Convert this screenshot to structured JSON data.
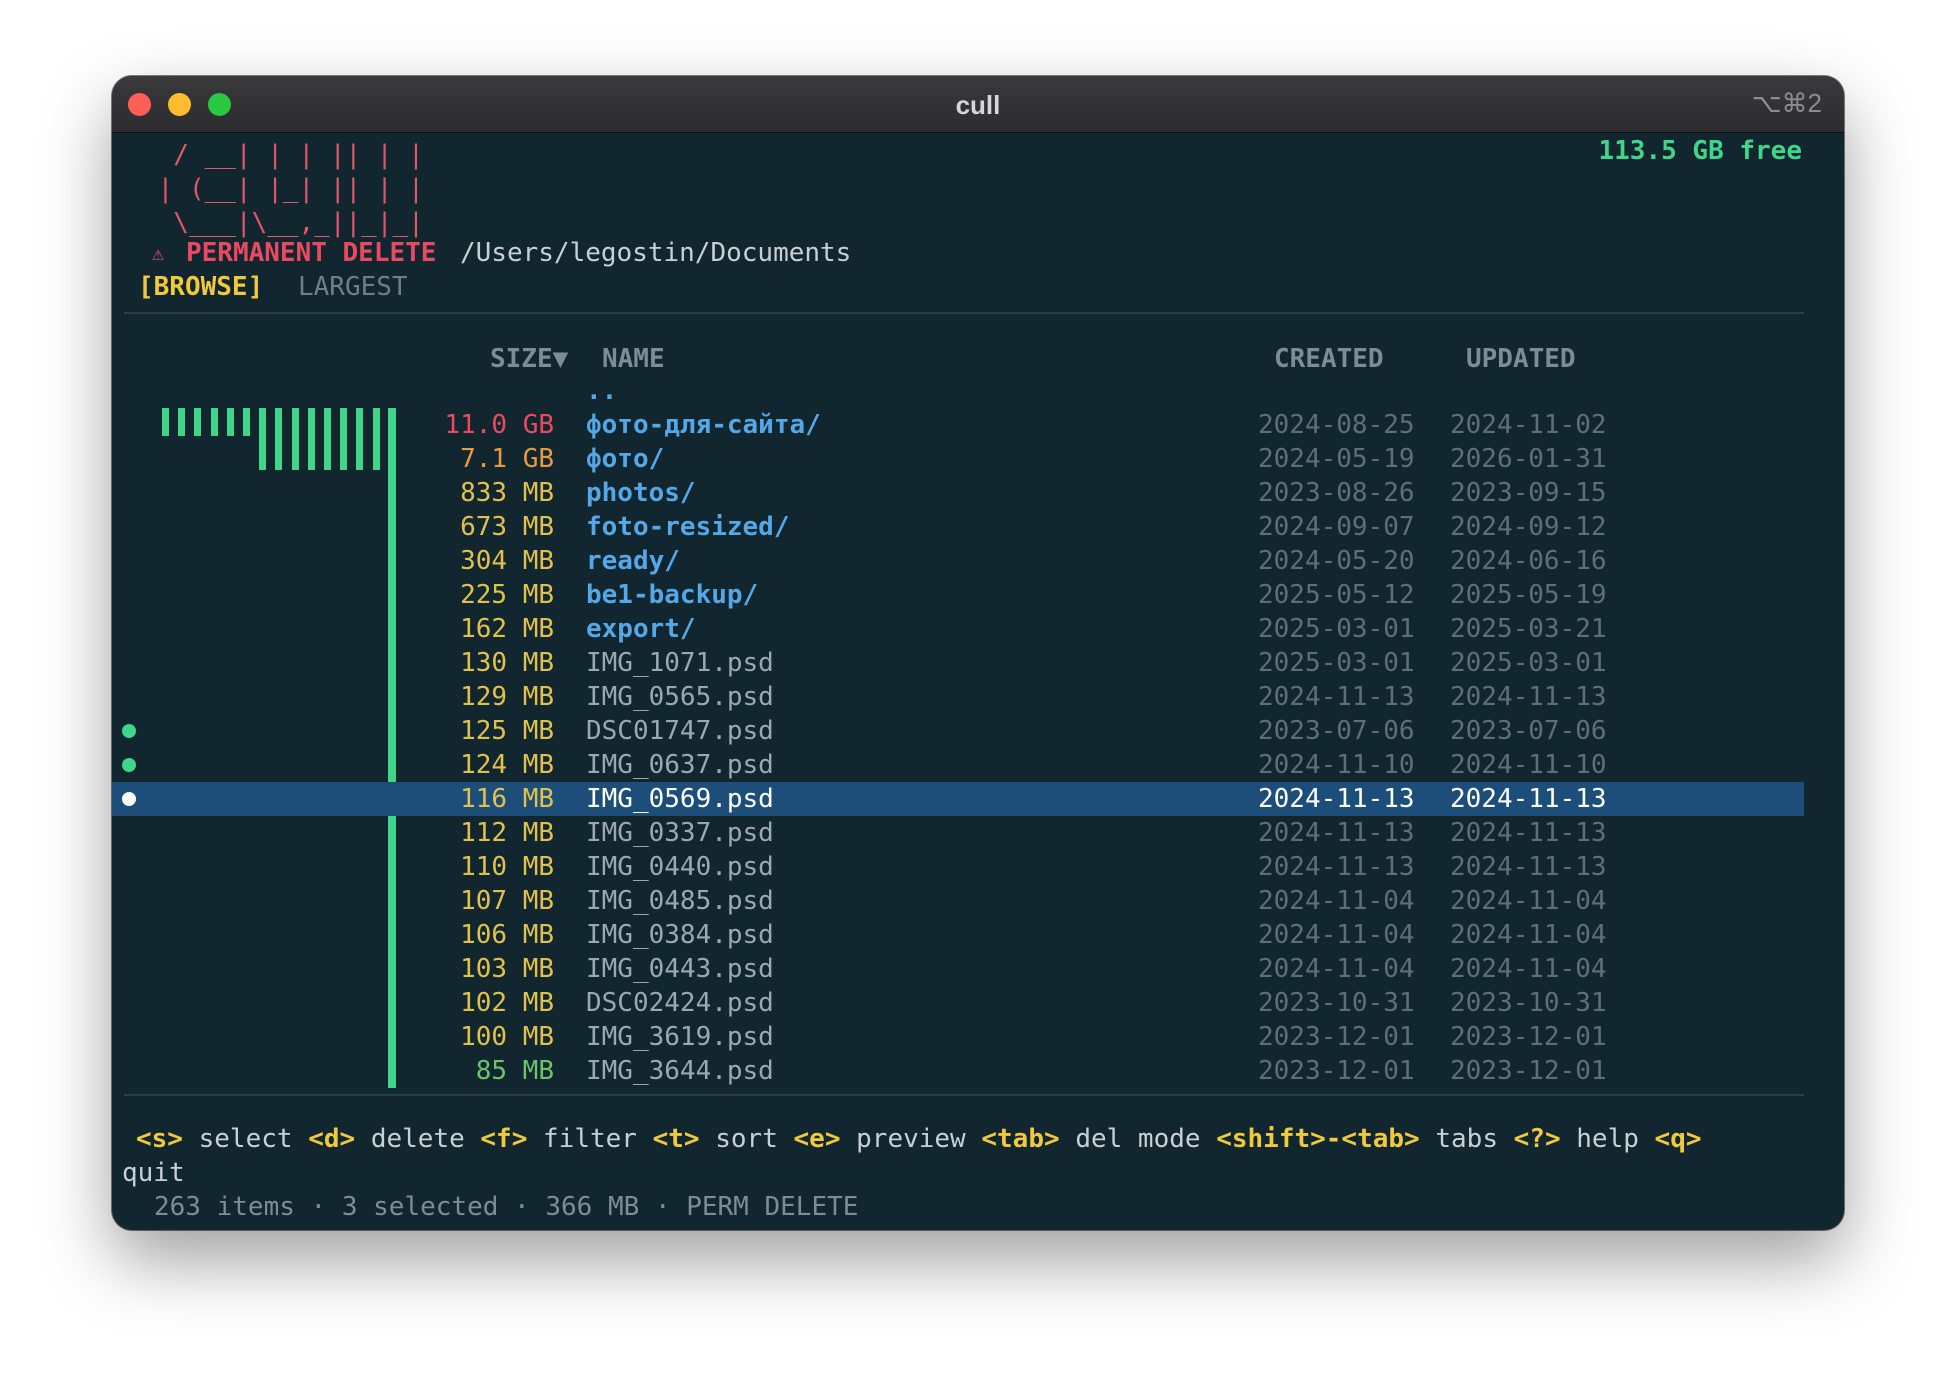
{
  "window": {
    "title": "cull",
    "shortcut": "⌥⌘2"
  },
  "logo_art": "  / __| | | || | |\n | (__| |_| || | |\n  \\___|\\__,_||_|_|",
  "header": {
    "free_space": "113.5 GB free",
    "warning_icon": "⚠",
    "mode_label": "PERMANENT DELETE",
    "path": "/Users/legostin/Documents"
  },
  "tabs": [
    {
      "label": "[BROWSE]",
      "active": true
    },
    {
      "label": "LARGEST",
      "active": false
    }
  ],
  "columns": {
    "size": "SIZE▼",
    "name": "NAME",
    "created": "CREATED",
    "updated": "UPDATED"
  },
  "parent_entry": "..",
  "size_bar_levels": [
    1,
    1,
    1,
    1,
    1,
    1,
    2,
    2,
    2,
    2,
    2,
    2,
    2,
    2
  ],
  "rows": [
    {
      "size": "11.0 GB",
      "name": "фото-для-сайта/",
      "created": "2024-08-25",
      "updated": "2024-11-02",
      "dir": true,
      "size_color": "red",
      "marked": false,
      "selected": false
    },
    {
      "size": "7.1 GB",
      "name": "фото/",
      "created": "2024-05-19",
      "updated": "2026-01-31",
      "dir": true,
      "size_color": "orange",
      "marked": false,
      "selected": false
    },
    {
      "size": "833 MB",
      "name": "photos/",
      "created": "2023-08-26",
      "updated": "2023-09-15",
      "dir": true,
      "size_color": "yellow",
      "marked": false,
      "selected": false
    },
    {
      "size": "673 MB",
      "name": "foto-resized/",
      "created": "2024-09-07",
      "updated": "2024-09-12",
      "dir": true,
      "size_color": "yellow",
      "marked": false,
      "selected": false
    },
    {
      "size": "304 MB",
      "name": "ready/",
      "created": "2024-05-20",
      "updated": "2024-06-16",
      "dir": true,
      "size_color": "yellow",
      "marked": false,
      "selected": false
    },
    {
      "size": "225 MB",
      "name": "be1-backup/",
      "created": "2025-05-12",
      "updated": "2025-05-19",
      "dir": true,
      "size_color": "yellow",
      "marked": false,
      "selected": false
    },
    {
      "size": "162 MB",
      "name": "export/",
      "created": "2025-03-01",
      "updated": "2025-03-21",
      "dir": true,
      "size_color": "yellow",
      "marked": false,
      "selected": false
    },
    {
      "size": "130 MB",
      "name": "IMG_1071.psd",
      "created": "2025-03-01",
      "updated": "2025-03-01",
      "dir": false,
      "size_color": "yellow",
      "marked": false,
      "selected": false
    },
    {
      "size": "129 MB",
      "name": "IMG_0565.psd",
      "created": "2024-11-13",
      "updated": "2024-11-13",
      "dir": false,
      "size_color": "yellow",
      "marked": false,
      "selected": false
    },
    {
      "size": "125 MB",
      "name": "DSC01747.psd",
      "created": "2023-07-06",
      "updated": "2023-07-06",
      "dir": false,
      "size_color": "yellow",
      "marked": true,
      "selected": false
    },
    {
      "size": "124 MB",
      "name": "IMG_0637.psd",
      "created": "2024-11-10",
      "updated": "2024-11-10",
      "dir": false,
      "size_color": "yellow",
      "marked": true,
      "selected": false
    },
    {
      "size": "116 MB",
      "name": "IMG_0569.psd",
      "created": "2024-11-13",
      "updated": "2024-11-13",
      "dir": false,
      "size_color": "yellow",
      "marked": true,
      "selected": true
    },
    {
      "size": "112 MB",
      "name": "IMG_0337.psd",
      "created": "2024-11-13",
      "updated": "2024-11-13",
      "dir": false,
      "size_color": "yellow",
      "marked": false,
      "selected": false
    },
    {
      "size": "110 MB",
      "name": "IMG_0440.psd",
      "created": "2024-11-13",
      "updated": "2024-11-13",
      "dir": false,
      "size_color": "yellow",
      "marked": false,
      "selected": false
    },
    {
      "size": "107 MB",
      "name": "IMG_0485.psd",
      "created": "2024-11-04",
      "updated": "2024-11-04",
      "dir": false,
      "size_color": "yellow",
      "marked": false,
      "selected": false
    },
    {
      "size": "106 MB",
      "name": "IMG_0384.psd",
      "created": "2024-11-04",
      "updated": "2024-11-04",
      "dir": false,
      "size_color": "yellow",
      "marked": false,
      "selected": false
    },
    {
      "size": "103 MB",
      "name": "IMG_0443.psd",
      "created": "2024-11-04",
      "updated": "2024-11-04",
      "dir": false,
      "size_color": "yellow",
      "marked": false,
      "selected": false
    },
    {
      "size": "102 MB",
      "name": "DSC02424.psd",
      "created": "2023-10-31",
      "updated": "2023-10-31",
      "dir": false,
      "size_color": "yellow",
      "marked": false,
      "selected": false
    },
    {
      "size": "100 MB",
      "name": "IMG_3619.psd",
      "created": "2023-12-01",
      "updated": "2023-12-01",
      "dir": false,
      "size_color": "yellow",
      "marked": false,
      "selected": false
    },
    {
      "size": "85 MB",
      "name": "IMG_3644.psd",
      "created": "2023-12-01",
      "updated": "2023-12-01",
      "dir": false,
      "size_color": "green",
      "marked": false,
      "selected": false
    }
  ],
  "keybindings": [
    {
      "key": "<s>",
      "action": "select"
    },
    {
      "key": "<d>",
      "action": "delete"
    },
    {
      "key": "<f>",
      "action": "filter"
    },
    {
      "key": "<t>",
      "action": "sort"
    },
    {
      "key": "<e>",
      "action": "preview"
    },
    {
      "key": "<tab>",
      "action": "del mode"
    },
    {
      "key": "<shift>-<tab>",
      "action": "tabs"
    },
    {
      "key": "<?>",
      "action": "help"
    },
    {
      "key": "<q>",
      "action": "quit"
    }
  ],
  "status_line": "263 items · 3 selected · 366 MB · PERM DELETE",
  "colors": {
    "background": "#122630",
    "accent_green": "#3fd68a",
    "danger_red": "#e94a62",
    "key_yellow": "#f0c93c",
    "directory_blue": "#55a8e8",
    "selection": "#1d4e79"
  }
}
